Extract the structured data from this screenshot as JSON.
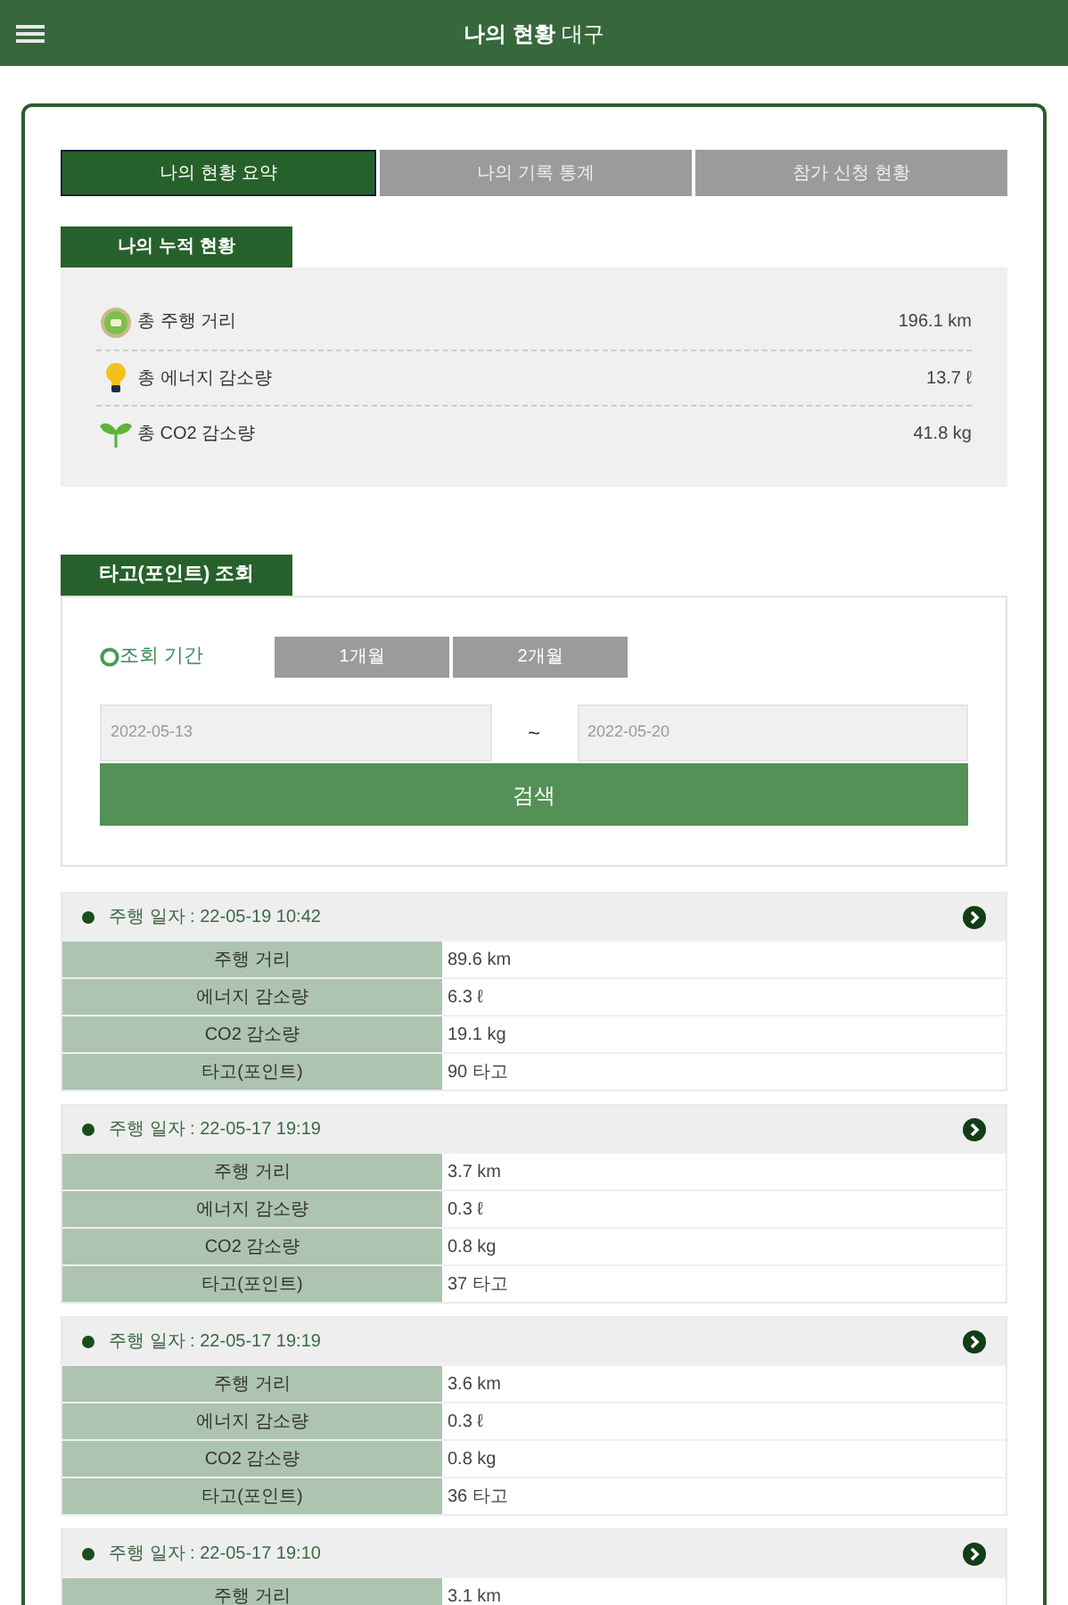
{
  "header": {
    "title_bold": "나의 현황",
    "title_rest": "대구"
  },
  "tabs": [
    {
      "label": "나의 현황 요약",
      "selected": true
    },
    {
      "label": "나의 기록 통계",
      "selected": false
    },
    {
      "label": "참가 신청 현황",
      "selected": false
    }
  ],
  "summary": {
    "title": "나의 누적 현황",
    "items": [
      {
        "kind": "distance",
        "label": "총 주행 거리",
        "value": "196.1 km"
      },
      {
        "kind": "energy",
        "label": "총 에너지 감소량",
        "value": "13.7 ℓ"
      },
      {
        "kind": "co2",
        "label": "총 CO2 감소량",
        "value": "41.8 kg"
      }
    ]
  },
  "search": {
    "title": "타고(포인트) 조회",
    "period_label": "조회 기간",
    "period_buttons": [
      "1개월",
      "2개월"
    ],
    "from": "2022-05-13",
    "separator": "~",
    "to": "2022-05-20",
    "button": "검색"
  },
  "records": [
    {
      "date": "주행 일자 : 22-05-19 10:42",
      "rows": [
        {
          "label": "주행 거리",
          "value": "89.6 km"
        },
        {
          "label": "에너지 감소량",
          "value": "6.3 ℓ"
        },
        {
          "label": "CO2 감소량",
          "value": "19.1 kg"
        },
        {
          "label": "타고(포인트)",
          "value": "90 타고"
        }
      ]
    },
    {
      "date": "주행 일자 : 22-05-17 19:19",
      "rows": [
        {
          "label": "주행 거리",
          "value": "3.7 km"
        },
        {
          "label": "에너지 감소량",
          "value": "0.3 ℓ"
        },
        {
          "label": "CO2 감소량",
          "value": "0.8 kg"
        },
        {
          "label": "타고(포인트)",
          "value": "37 타고"
        }
      ]
    },
    {
      "date": "주행 일자 : 22-05-17 19:19",
      "rows": [
        {
          "label": "주행 거리",
          "value": "3.6 km"
        },
        {
          "label": "에너지 감소량",
          "value": "0.3 ℓ"
        },
        {
          "label": "CO2 감소량",
          "value": "0.8 kg"
        },
        {
          "label": "타고(포인트)",
          "value": "36 타고"
        }
      ]
    },
    {
      "date": "주행 일자 : 22-05-17 19:10",
      "rows": [
        {
          "label": "주행 거리",
          "value": "3.1 km"
        }
      ]
    }
  ]
}
